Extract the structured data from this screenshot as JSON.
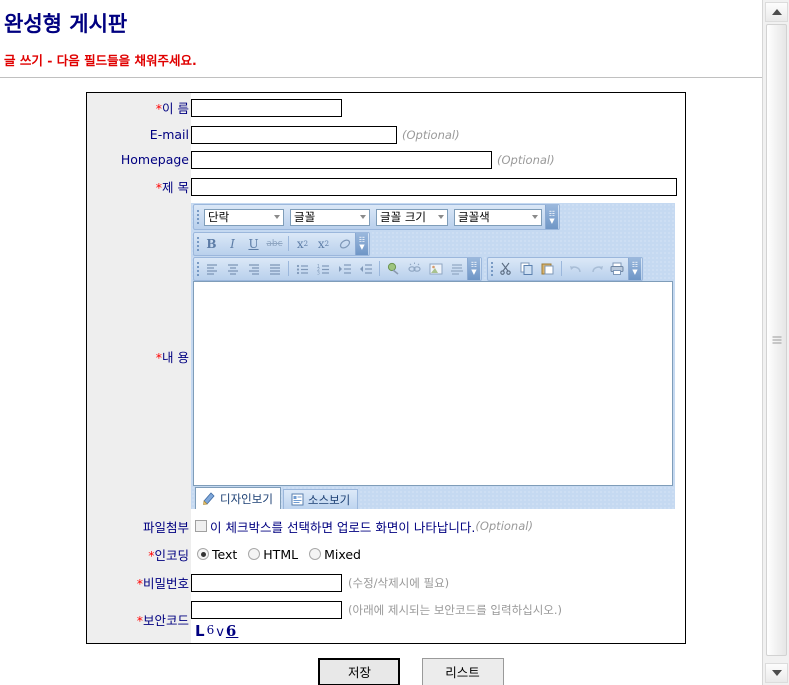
{
  "header": {
    "title": "완성형 게시판",
    "subtitle": "글 쓰기 - 다음 필드들을 채워주세요."
  },
  "form": {
    "required_mark": "*",
    "fields": {
      "name": {
        "label": "이 름",
        "value": ""
      },
      "email": {
        "label": "E-mail",
        "value": "",
        "note": "(Optional)"
      },
      "homepage": {
        "label": "Homepage",
        "value": "",
        "note": "(Optional)"
      },
      "subject": {
        "label": "제 목",
        "value": ""
      },
      "content": {
        "label": "내 용"
      },
      "attach": {
        "label": "파일첨부",
        "checkbox_label": "이 체크박스를 선택하면 업로드 화면이 나타납니다.",
        "note": "(Optional)",
        "checked": false
      },
      "encoding": {
        "label": "인코딩",
        "options": [
          "Text",
          "HTML",
          "Mixed"
        ],
        "selected": "Text"
      },
      "password": {
        "label": "비밀번호",
        "value": "",
        "note": "(수정/삭제시에 필요)"
      },
      "captcha": {
        "label": "보안코드",
        "value": "",
        "note": "(아래에 제시되는 보안코드를 입력하십시오.)",
        "code_chars": [
          "L",
          "6",
          "v",
          "6"
        ]
      }
    }
  },
  "editor": {
    "dropdowns": [
      {
        "name": "paragraph",
        "label": "단락"
      },
      {
        "name": "font",
        "label": "글꼴"
      },
      {
        "name": "font-size",
        "label": "글꼴 크기"
      },
      {
        "name": "font-color",
        "label": "글꼴색"
      }
    ],
    "format_buttons": [
      {
        "name": "bold",
        "glyph": "B"
      },
      {
        "name": "italic",
        "glyph": "I"
      },
      {
        "name": "underline",
        "glyph": "U"
      },
      {
        "name": "strikethrough",
        "glyph": "abc"
      },
      {
        "name": "superscript",
        "glyph": "x²"
      },
      {
        "name": "subscript",
        "glyph": "x₂"
      },
      {
        "name": "remove-format",
        "glyph": "⌫"
      }
    ],
    "paragraph_buttons": [
      {
        "name": "align-left"
      },
      {
        "name": "align-center"
      },
      {
        "name": "align-right"
      },
      {
        "name": "align-justify"
      },
      {
        "name": "bullet-list"
      },
      {
        "name": "numbered-list"
      },
      {
        "name": "indent"
      },
      {
        "name": "outdent"
      },
      {
        "name": "insert-link"
      },
      {
        "name": "remove-link"
      },
      {
        "name": "insert-image"
      },
      {
        "name": "horizontal-rule"
      }
    ],
    "clipboard_buttons": [
      {
        "name": "cut"
      },
      {
        "name": "copy"
      },
      {
        "name": "paste"
      },
      {
        "name": "undo"
      },
      {
        "name": "redo"
      },
      {
        "name": "print"
      }
    ],
    "tabs": [
      {
        "name": "design-view",
        "label": "디자인보기",
        "active": true
      },
      {
        "name": "source-view",
        "label": "소스보기",
        "active": false
      }
    ],
    "content": ""
  },
  "actions": {
    "save": "저장",
    "list": "리스트"
  },
  "colors": {
    "title": "#000080",
    "subtitle": "#e00000",
    "label": "#000080",
    "required": "#ff0000",
    "label_bg": "#eeeeee",
    "toolbar_bg": "#c5d9f1",
    "note": "#999999"
  }
}
